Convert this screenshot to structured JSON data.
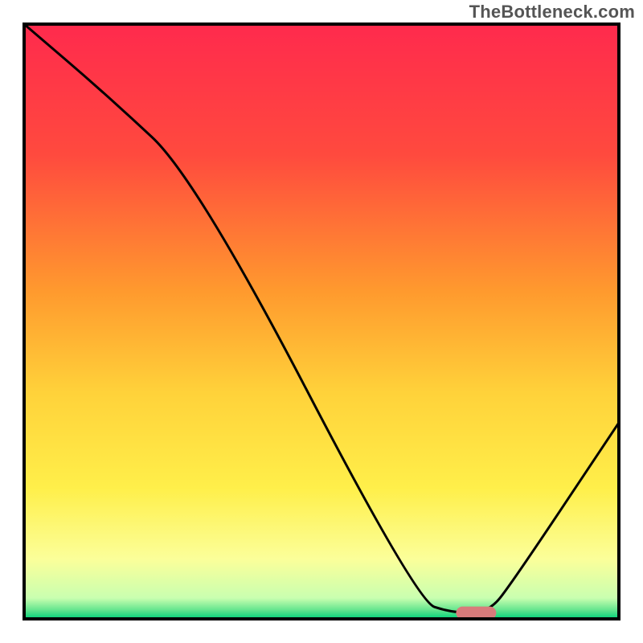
{
  "watermark": "TheBottleneck.com",
  "chart_data": {
    "type": "line",
    "title": "",
    "xlabel": "",
    "ylabel": "",
    "xlim": [
      0,
      100
    ],
    "ylim": [
      0,
      100
    ],
    "grid": false,
    "legend": false,
    "background_gradient": {
      "stops": [
        {
          "offset": 0.0,
          "color": "#ff2a4d"
        },
        {
          "offset": 0.22,
          "color": "#ff4a3e"
        },
        {
          "offset": 0.45,
          "color": "#ff9a2e"
        },
        {
          "offset": 0.62,
          "color": "#ffd23a"
        },
        {
          "offset": 0.78,
          "color": "#ffef4a"
        },
        {
          "offset": 0.9,
          "color": "#fbff9a"
        },
        {
          "offset": 0.965,
          "color": "#c9ffb0"
        },
        {
          "offset": 0.985,
          "color": "#64e58e"
        },
        {
          "offset": 1.0,
          "color": "#00d27a"
        }
      ]
    },
    "series": [
      {
        "name": "bottleneck-curve",
        "color": "#000000",
        "x": [
          0,
          14,
          29,
          66,
          72,
          78,
          82,
          100
        ],
        "values": [
          100,
          88,
          74,
          3,
          1,
          1,
          6,
          33
        ]
      }
    ],
    "marker": {
      "name": "optimal-point",
      "x": 76,
      "y": 1,
      "color": "#d87b7b",
      "shape": "pill"
    },
    "frame_color": "#000000",
    "frame_stroke_width": 4
  }
}
